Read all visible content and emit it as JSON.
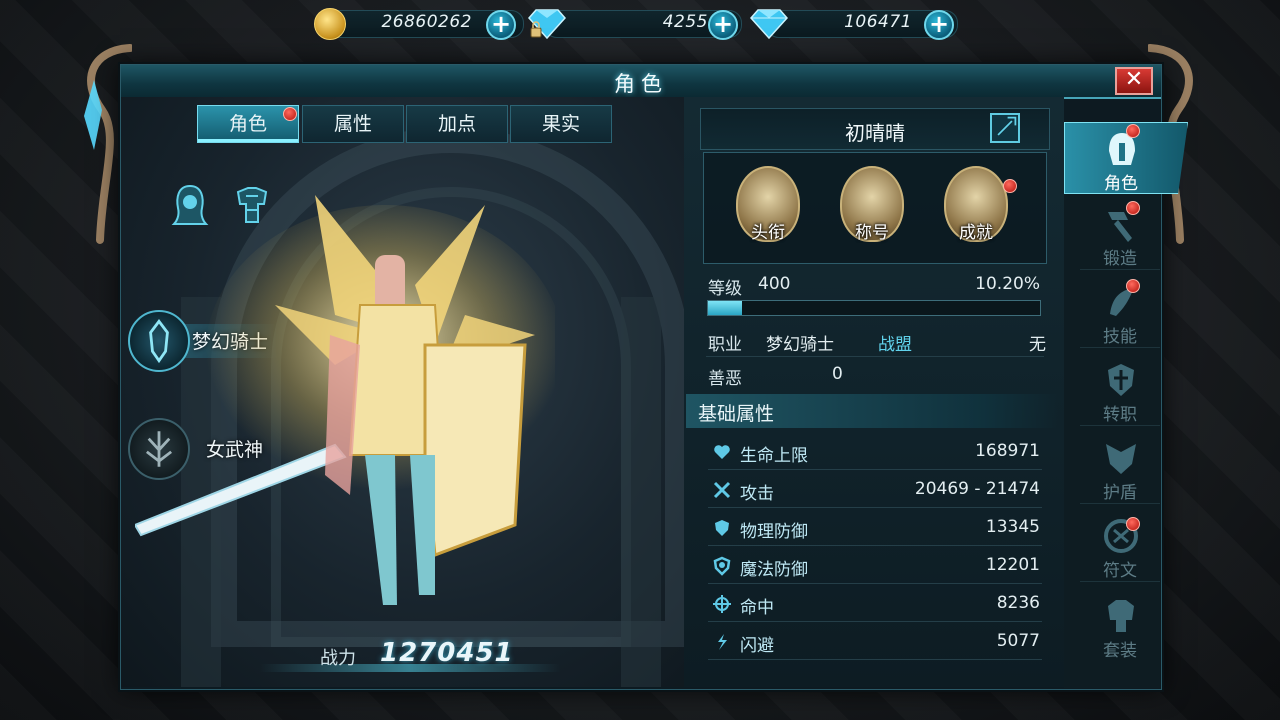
{
  "currency": {
    "gold": "26860262",
    "bound_diamond": "4255",
    "diamond": "106471"
  },
  "window": {
    "title": "角色",
    "close": "✕"
  },
  "tabs": [
    {
      "label": "角色",
      "active": true,
      "dot": true
    },
    {
      "label": "属性",
      "active": false,
      "dot": false
    },
    {
      "label": "加点",
      "active": false,
      "dot": false
    },
    {
      "label": "果实",
      "active": false,
      "dot": false
    }
  ],
  "classes": [
    {
      "name": "梦幻骑士",
      "active": true
    },
    {
      "name": "女武神",
      "active": false
    }
  ],
  "power": {
    "label": "战力",
    "value": "1270451"
  },
  "player": {
    "name": "初晴晴"
  },
  "badges": [
    {
      "label": "头衔",
      "dot": false
    },
    {
      "label": "称号",
      "dot": false
    },
    {
      "label": "成就",
      "dot": true
    }
  ],
  "stats": {
    "level_label": "等级",
    "level": "400",
    "exp_percent": "10.20%",
    "exp_fraction": 0.102,
    "job_label": "职业",
    "job": "梦幻骑士",
    "alliance_label": "战盟",
    "alliance": "无",
    "karma_label": "善恶",
    "karma": "0"
  },
  "section_title": "基础属性",
  "attributes": [
    {
      "name": "生命上限",
      "value": "168971",
      "icon": "heart-icon"
    },
    {
      "name": "攻击",
      "value": "20469 - 21474",
      "icon": "crossed-swords-icon"
    },
    {
      "name": "物理防御",
      "value": "13345",
      "icon": "shield-icon"
    },
    {
      "name": "魔法防御",
      "value": "12201",
      "icon": "magic-shield-icon"
    },
    {
      "name": "命中",
      "value": "8236",
      "icon": "crosshair-icon"
    },
    {
      "name": "闪避",
      "value": "5077",
      "icon": "dodge-icon"
    }
  ],
  "sidenav": [
    {
      "label": "角色",
      "active": true,
      "dot": true,
      "icon": "helmet-icon"
    },
    {
      "label": "锻造",
      "active": false,
      "dot": true,
      "icon": "hammer-icon"
    },
    {
      "label": "技能",
      "active": false,
      "dot": true,
      "icon": "skill-icon"
    },
    {
      "label": "转职",
      "active": false,
      "dot": false,
      "icon": "class-change-icon"
    },
    {
      "label": "护盾",
      "active": false,
      "dot": false,
      "icon": "guard-icon"
    },
    {
      "label": "符文",
      "active": false,
      "dot": true,
      "icon": "rune-icon"
    },
    {
      "label": "套装",
      "active": false,
      "dot": false,
      "icon": "armor-set-icon"
    }
  ],
  "colors": {
    "accent": "#61d3ec",
    "alert": "#d8231a",
    "gold": "#e8c35a"
  }
}
